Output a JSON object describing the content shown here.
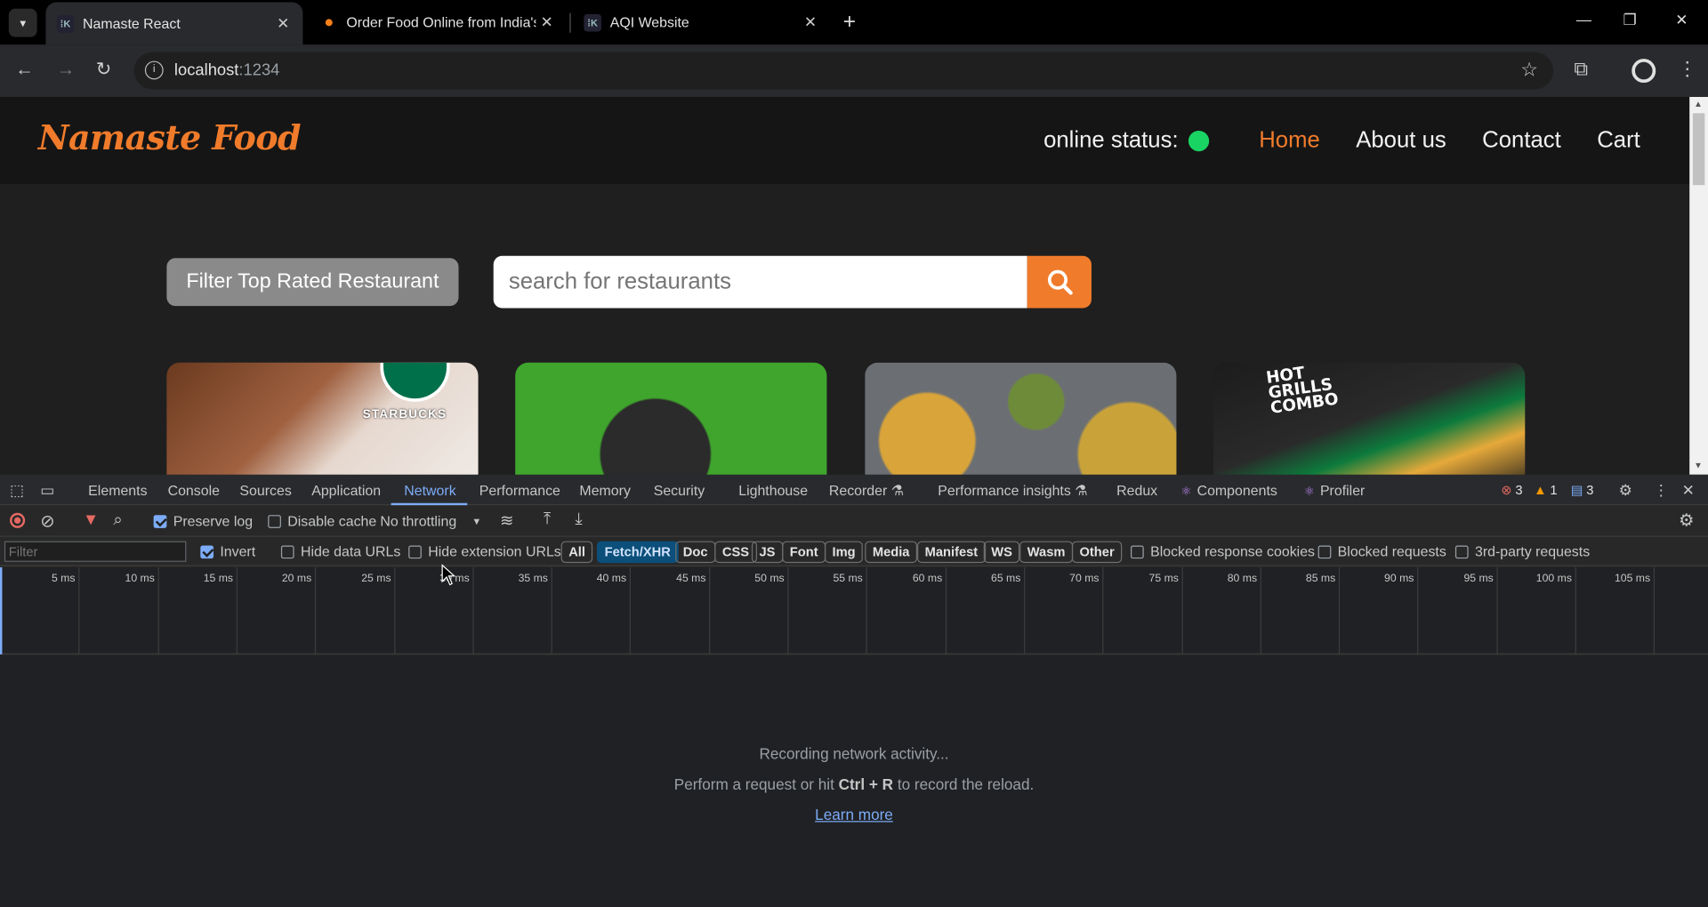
{
  "browser": {
    "tabs": [
      {
        "title": "Namaste React",
        "favicon": "react-app-icon",
        "active": true
      },
      {
        "title": "Order Food Online from India's",
        "favicon": "swiggy-icon",
        "active": false
      },
      {
        "title": "AQI Website",
        "favicon": "react-app-icon",
        "active": false
      }
    ],
    "url_host": "localhost",
    "url_port": ":1234"
  },
  "page": {
    "logo": "Namaste Food",
    "online_status_label": "online status:",
    "online_status_color": "#19d463",
    "nav": [
      "Home",
      "About us",
      "Contact",
      "Cart"
    ],
    "filter_button": "Filter Top Rated Restaurant",
    "search_placeholder": "search for restaurants",
    "cards": [
      {
        "brand": "STARBUCKS"
      },
      {
        "brand": ""
      },
      {
        "brand": ""
      },
      {
        "brand": "HOT GRILLS COMBO"
      }
    ]
  },
  "devtools": {
    "tabs": [
      "Elements",
      "Console",
      "Sources",
      "Application",
      "Network",
      "Performance",
      "Memory",
      "Security",
      "Lighthouse",
      "Recorder",
      "Performance insights",
      "Redux",
      "Components",
      "Profiler"
    ],
    "active_tab": "Network",
    "errors": "3",
    "warnings": "1",
    "messages": "3",
    "toolbar": {
      "preserve_log": "Preserve log",
      "disable_cache": "Disable cache",
      "throttling": "No throttling"
    },
    "filter": {
      "placeholder": "Filter",
      "invert": "Invert",
      "hide_data_urls": "Hide data URLs",
      "hide_extension_urls": "Hide extension URLs",
      "types": [
        "All",
        "Fetch/XHR",
        "Doc",
        "CSS",
        "JS",
        "Font",
        "Img",
        "Media",
        "Manifest",
        "WS",
        "Wasm",
        "Other"
      ],
      "selected_type": "Fetch/XHR",
      "blocked_response_cookies": "Blocked response cookies",
      "blocked_requests": "Blocked requests",
      "third_party": "3rd-party requests"
    },
    "timeline_ticks": [
      "5 ms",
      "10 ms",
      "15 ms",
      "20 ms",
      "25 ms",
      "30 ms",
      "35 ms",
      "40 ms",
      "45 ms",
      "50 ms",
      "55 ms",
      "60 ms",
      "65 ms",
      "70 ms",
      "75 ms",
      "80 ms",
      "85 ms",
      "90 ms",
      "95 ms",
      "100 ms",
      "105 ms"
    ],
    "empty": {
      "line1": "Recording network activity...",
      "line2_pre": "Perform a request or hit ",
      "line2_key": "Ctrl + R",
      "line2_post": " to record the reload.",
      "learn_more": "Learn more"
    }
  }
}
